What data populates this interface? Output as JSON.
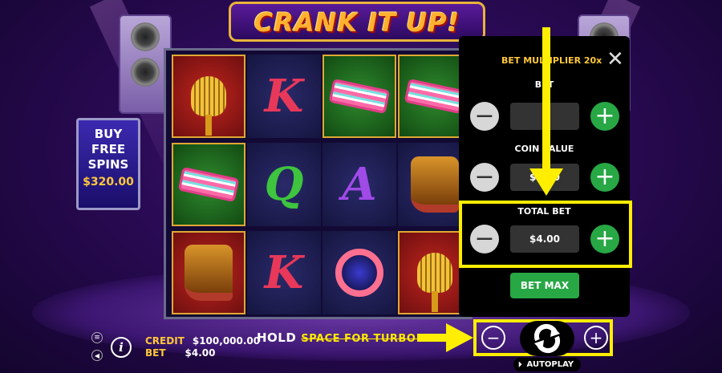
{
  "game": {
    "title": "CRANK IT UP!"
  },
  "buy_feature": {
    "label": "BUY\nFREE\nSPINS",
    "price": "$320.00"
  },
  "reels": [
    [
      "microphone",
      "glasses",
      "boots"
    ],
    [
      "K",
      "Q",
      "K"
    ],
    [
      "glasses",
      "A",
      "headphones"
    ],
    [
      "glasses",
      "boots",
      "microphone"
    ]
  ],
  "symbol_colors": {
    "K": "#e8385a",
    "Q": "#3ec43e",
    "A": "#a04ae8"
  },
  "status": {
    "hold_text": "HOLD",
    "hold_hidden_text": "SPACE FOR TURBO SPIN",
    "credit_label": "CREDIT",
    "credit_value": "$100,000.00",
    "bet_label": "BET",
    "bet_value": "$4.00"
  },
  "controls": {
    "autoplay_label": "AUTOPLAY",
    "menu_icon": "hamburger-icon",
    "info_icon": "info-icon",
    "sound_icon": "speaker-icon",
    "spin_icon": "spin-arrows-icon"
  },
  "bet_panel": {
    "multiplier_label": "BET MULTIPLIER 20x",
    "bet_label": "BET",
    "bet_value": "",
    "coin_value_label": "COIN VALUE",
    "coin_value": "$0.20",
    "total_bet_label": "TOTAL BET",
    "total_bet_value": "$4.00",
    "bet_max_label": "BET MAX",
    "close_label": "✕",
    "minus_label": "−",
    "plus_label": "+"
  },
  "accent_colors": {
    "highlight": "#ffee00",
    "green": "#28a745",
    "gold": "#ffc83a"
  }
}
